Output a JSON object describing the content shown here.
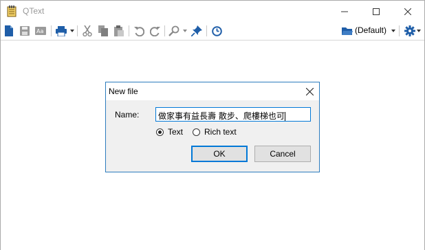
{
  "window": {
    "title": "QText"
  },
  "toolbar": {
    "items": [
      "new-file-icon",
      "save-icon",
      "rename-icon",
      "print-icon",
      "cut-icon",
      "copy-icon",
      "paste-icon",
      "undo-icon",
      "redo-icon",
      "find-icon",
      "pin-icon",
      "clock-icon"
    ],
    "profile_label": "(Default)"
  },
  "dialog": {
    "title": "New file",
    "name_label": "Name:",
    "name_value": "做家事有益長壽 散步、爬樓梯也可",
    "radio_text_label": "Text",
    "radio_rich_label": "Rich text",
    "selected_format": "Text",
    "ok_label": "OK",
    "cancel_label": "Cancel"
  },
  "colors": {
    "accent": "#0078d7",
    "toolbar_blue": "#1f5ea8",
    "dialog_border": "#2b7bbd"
  }
}
